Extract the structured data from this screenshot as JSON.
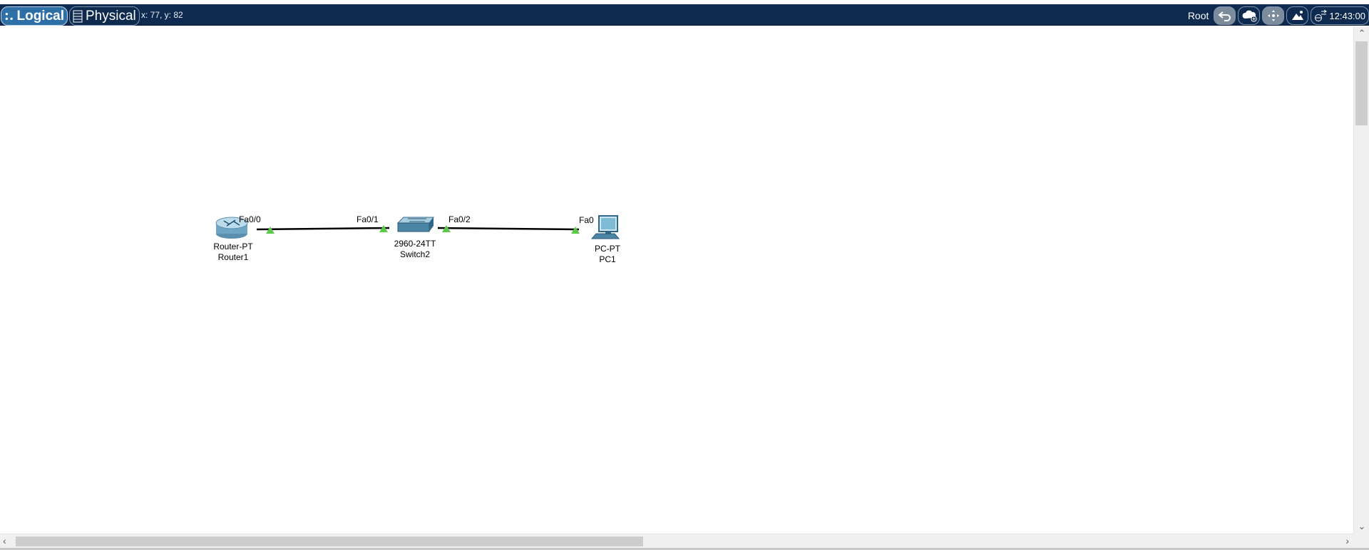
{
  "toolbar": {
    "logical_label": "Logical",
    "physical_label": "Physical",
    "cursor_coords": "x: 77, y: 82",
    "root_label": "Root",
    "clock": "12:43:00"
  },
  "topology": {
    "devices": [
      {
        "model": "Router-PT",
        "name": "Router1"
      },
      {
        "model": "2960-24TT",
        "name": "Switch2"
      },
      {
        "model": "PC-PT",
        "name": "PC1"
      }
    ],
    "ports": [
      "Fa0/0",
      "Fa0/1",
      "Fa0/2",
      "Fa0"
    ],
    "link_status_color": "#5cc84a"
  },
  "colors": {
    "topbar_bg": "#0e2a4f",
    "active_tab": "#2f6fa8"
  },
  "icons": {
    "logical": "network-nodes-icon",
    "physical": "rack-icon",
    "back": "back-arrow-icon",
    "cloud": "cloud-add-icon",
    "move": "move-icon",
    "image": "background-image-icon",
    "viewport": "viewport-icon"
  }
}
